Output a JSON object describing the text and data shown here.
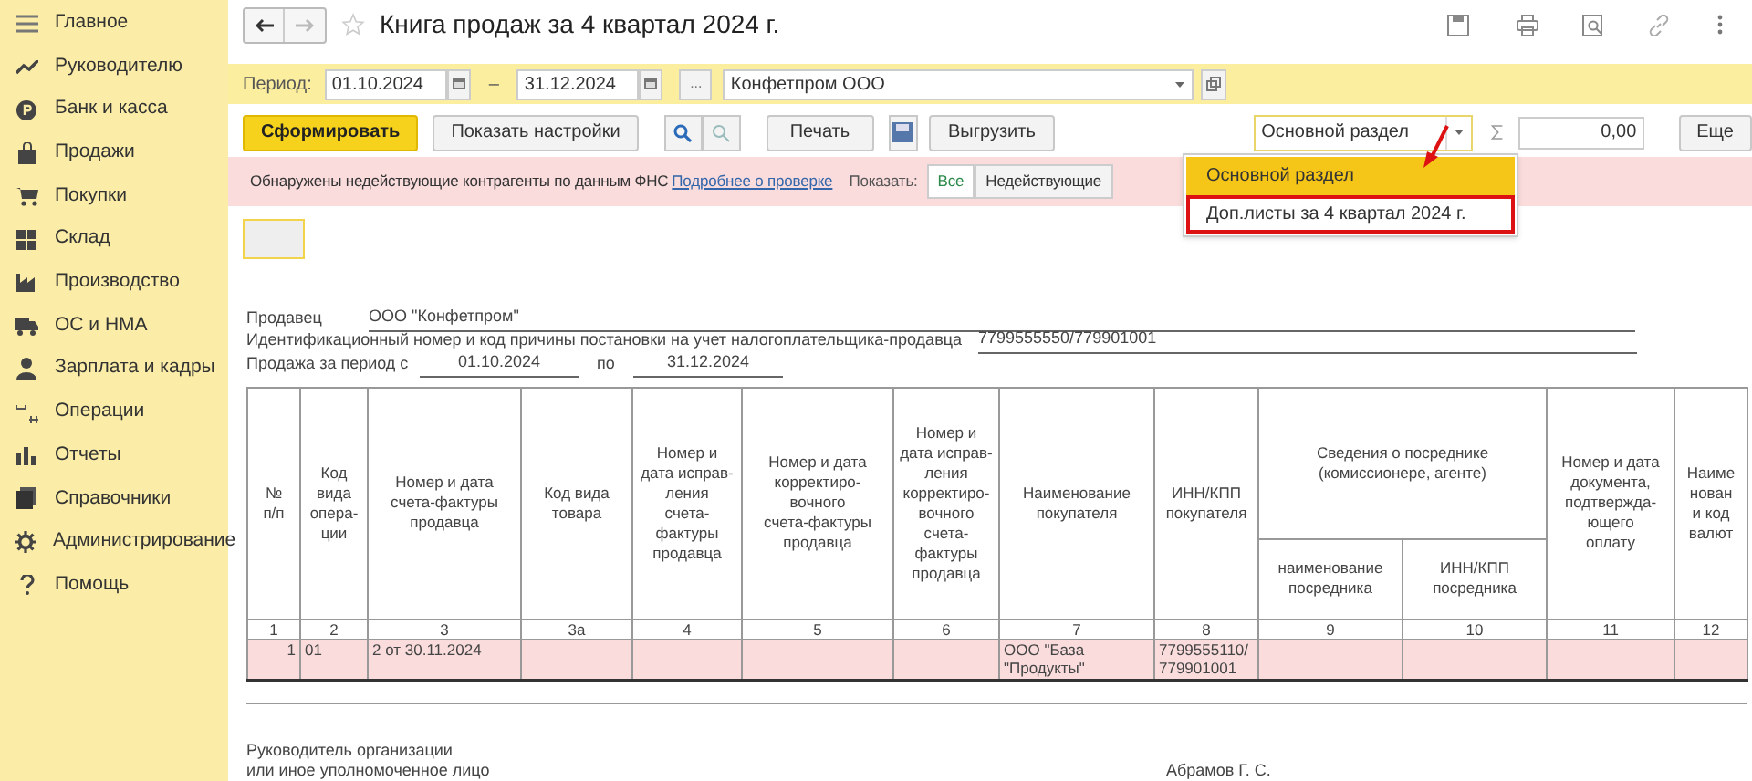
{
  "sidebar": {
    "items": [
      {
        "label": "Главное"
      },
      {
        "label": "Руководителю"
      },
      {
        "label": "Банк и касса"
      },
      {
        "label": "Продажи"
      },
      {
        "label": "Покупки"
      },
      {
        "label": "Склад"
      },
      {
        "label": "Производство"
      },
      {
        "label": "ОС и НМА"
      },
      {
        "label": "Зарплата и кадры"
      },
      {
        "label": "Операции"
      },
      {
        "label": "Отчеты"
      },
      {
        "label": "Справочники"
      },
      {
        "label": "Администрирование"
      },
      {
        "label": "Помощь"
      }
    ]
  },
  "window": {
    "title": "Книга продаж за 4 квартал 2024 г.",
    "favorite": false
  },
  "period": {
    "label": "Период:",
    "from": "01.10.2024",
    "dash": "–",
    "to": "31.12.2024",
    "more_button": "...",
    "organization": "Конфетпром ООО"
  },
  "toolbar": {
    "generate": "Сформировать",
    "settings": "Показать настройки",
    "print": "Печать",
    "export": "Выгрузить",
    "section": "Основной раздел",
    "sum": "0,00",
    "more": "Еще"
  },
  "section_dropdown": {
    "items": [
      {
        "label": "Основной раздел",
        "selected": true,
        "highlighted": false
      },
      {
        "label": "Доп.листы за 4 квартал 2024 г.",
        "selected": false,
        "highlighted": true
      }
    ]
  },
  "banner": {
    "text": "Обнаружены недействующие контрагенты по данным ФНС",
    "link": "Подробнее о проверке",
    "show_label": "Показать:",
    "filters": [
      {
        "label": "Все",
        "selected": true
      },
      {
        "label": "Недействующие",
        "selected": false
      }
    ]
  },
  "report": {
    "seller_label": "Продавец",
    "seller": "ООО \"Конфетпром\"",
    "inn_label": "Идентификационный номер и код причины постановки на учет налогоплательщика-продавца",
    "inn": "7799555550/779901001",
    "period_label": "Продажа за период с",
    "period_from": "01.10.2024",
    "period_to_label": "по",
    "period_to": "31.12.2024",
    "columns": [
      {
        "header": "№\nп/п",
        "number": "1"
      },
      {
        "header": "Код\nвида\nопера-\nции",
        "number": "2"
      },
      {
        "header": "Номер и дата\nсчета-фактуры\nпродавца",
        "number": "3"
      },
      {
        "header": "Код вида\nтовара",
        "number": "3а"
      },
      {
        "header": "Номер и\nдата исправ-\nления\nсчета-\nфактуры\nпродавца",
        "number": "4"
      },
      {
        "header": "Номер и дата\nкорректиро-\nвочного\nсчета-фактуры\nпродавца",
        "number": "5"
      },
      {
        "header": "Номер и\nдата исправ-\nления\nкорректиро-\nвочного\nсчета-\nфактуры\nпродавца",
        "number": "6"
      },
      {
        "header": "Наименование\nпокупателя",
        "number": "7"
      },
      {
        "header": "ИНН/КПП\nпокупателя",
        "number": "8"
      },
      {
        "group": "Сведения о посреднике\n(комиссионере, агенте)",
        "children": [
          {
            "header": "наименование\nпосредника",
            "number": "9"
          },
          {
            "header": "ИНН/КПП\nпосредника",
            "number": "10"
          }
        ]
      },
      {
        "header": "Номер и дата\nдокумента,\nподтвержда-\nющего\nоплату",
        "number": "11"
      },
      {
        "header": "Наиме\nнован\nи код\nвалют",
        "number": "12"
      }
    ],
    "rows": [
      {
        "cells": [
          "1",
          "01",
          "2 от 30.11.2024",
          null,
          null,
          null,
          null,
          "ООО \"База \"Продукты\"",
          "7799555110/\n779901001",
          null,
          null,
          null,
          null
        ]
      }
    ],
    "signature_label": "Руководитель организации\nили иное уполномоченное лицо",
    "signature_name": "Абрамов Г. С."
  }
}
